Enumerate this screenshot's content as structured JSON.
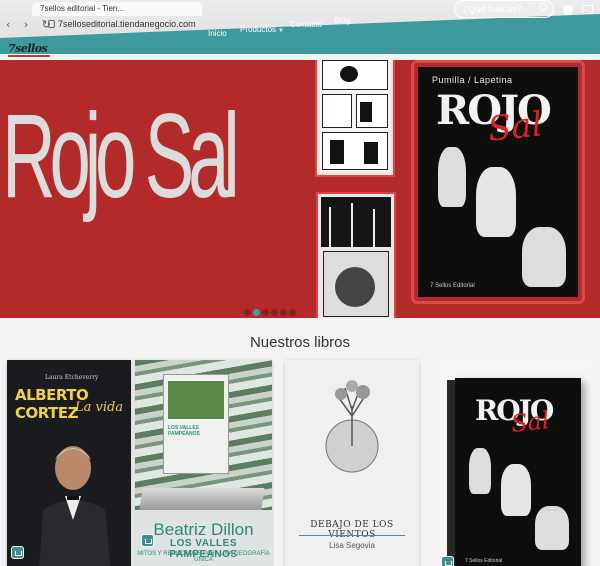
{
  "browser": {
    "tab_title": "7sellos editorial - Tien...",
    "url": "7selloseditorial.tiendanegocio.com"
  },
  "header": {
    "logo": "7sellos",
    "nav": [
      "Inicio",
      "Productos",
      "Contacto",
      "Blog"
    ],
    "search_placeholder": "¿Qué buscás?"
  },
  "hero": {
    "title": "Rojo Sal",
    "cover_authors": "Pumilla / Lapetina",
    "cover_title_main": "ROJO",
    "cover_title_accent": "Sal",
    "cover_publisher": "7 Sellos Editorial",
    "slides": 6,
    "active_slide": 2
  },
  "section": {
    "title": "Nuestros libros"
  },
  "books": [
    {
      "author": "Laura Etcheverry",
      "title": "ALBERTO CORTEZ",
      "subtitle": "La vida"
    },
    {
      "author": "Beatriz Dillon",
      "title": "LOS VALLES PAMPEANOS",
      "subtitle": "MITOS Y REALIDADES PARA UNA GEOGRAFÍA ÚNICA",
      "inset_title": "LOS VALLES PAMPEANOS"
    },
    {
      "title": "DEBAJO DE LOS VIENTOS",
      "author": "Lisa Segovia"
    },
    {
      "title_main": "ROJO",
      "title_accent": "Sal",
      "publisher": "7 Sellos Editorial"
    }
  ],
  "colors": {
    "header_teal": "#3d9a9e",
    "hero_red": "#b32a2a",
    "accent_teal": "#3d8f95",
    "title_yellow": "#f0d24a"
  }
}
